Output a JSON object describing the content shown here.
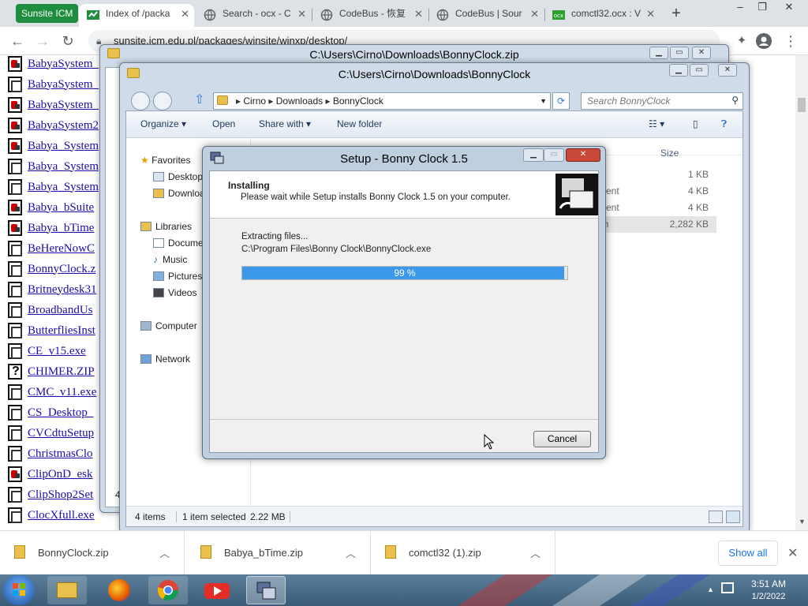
{
  "browser": {
    "profile_label": "Sunsite ICM",
    "tabs": [
      {
        "label": "Index of /packa",
        "active": true
      },
      {
        "label": "Search - ocx - C"
      },
      {
        "label": "CodeBus - 恢复"
      },
      {
        "label": "CodeBus | Sour"
      },
      {
        "label": "comctl32.ocx : V"
      }
    ],
    "new_tab_label": "+",
    "url": "sunsite.icm.edu.pl/packages/winsite/winxp/desktop/",
    "window_controls": [
      "–",
      "❐",
      "✕"
    ]
  },
  "listing": {
    "files": [
      {
        "name": "BabyaSystem_",
        "icon": "red"
      },
      {
        "name": "BabyaSystem_",
        "icon": "gray"
      },
      {
        "name": "BabyaSystem_",
        "icon": "red"
      },
      {
        "name": "BabyaSystem2",
        "icon": "red"
      },
      {
        "name": "Babya_System",
        "icon": "red"
      },
      {
        "name": "Babya_System",
        "icon": "gray"
      },
      {
        "name": "Babya_System",
        "icon": "gray"
      },
      {
        "name": "Babya_bSuite",
        "icon": "red"
      },
      {
        "name": "Babya_bTime",
        "icon": "red"
      },
      {
        "name": "BeHereNowC",
        "icon": "gray"
      },
      {
        "name": "BonnyClock.z",
        "icon": "gray"
      },
      {
        "name": "Britneydesk31",
        "icon": "gray"
      },
      {
        "name": "BroadbandUs",
        "icon": "gray"
      },
      {
        "name": "ButterfliesInst",
        "icon": "gray"
      },
      {
        "name": "CE_v15.exe",
        "icon": "gray"
      },
      {
        "name": "CHIMER.ZIP",
        "icon": "q"
      },
      {
        "name": "CMC_v11.exe",
        "icon": "gray"
      },
      {
        "name": "CS_Desktop_",
        "icon": "gray"
      },
      {
        "name": "CVCdtuSetup",
        "icon": "gray"
      },
      {
        "name": "ChristmasClo",
        "icon": "gray"
      },
      {
        "name": "ClipOnD_esk",
        "icon": "red"
      },
      {
        "name": "ClipShop2Set",
        "icon": "gray"
      },
      {
        "name": "ClocXfull.exe",
        "icon": "gray"
      }
    ]
  },
  "zip_window": {
    "title": "C:\\Users\\Cirno\\Downloads\\BonnyClock.zip",
    "status_fragment": "4"
  },
  "explorer": {
    "title": "C:\\Users\\Cirno\\Downloads\\BonnyClock",
    "breadcrumb": [
      "Cirno",
      "Downloads",
      "BonnyClock"
    ],
    "search_placeholder": "Search BonnyClock",
    "commands": {
      "organize": "Organize ▾",
      "open": "Open",
      "share_with": "Share with ▾",
      "new_folder": "New folder"
    },
    "nav": {
      "favorites": "Favorites",
      "desktop": "Desktop",
      "downloads": "Downloa",
      "libraries": "Libraries",
      "documents": "Documen",
      "music": "Music",
      "pictures": "Pictures",
      "videos": "Videos",
      "computer": "Computer",
      "network": "Network"
    },
    "size_header": "Size",
    "rows": [
      {
        "type_fragment": "",
        "size": "1 KB"
      },
      {
        "type_fragment": "ment",
        "size": "4 KB"
      },
      {
        "type_fragment": "ment",
        "size": "4 KB"
      },
      {
        "type_fragment": "on",
        "size": "2,282 KB",
        "selected": true
      }
    ],
    "status_items": "4 items",
    "status_selected": "1 item selected",
    "status_size": "2.22 MB"
  },
  "setup": {
    "title": "Setup - Bonny Clock 1.5",
    "heading": "Installing",
    "subheading": "Please wait while Setup installs Bonny Clock 1.5 on your computer.",
    "status_line": "Extracting files...",
    "current_file": "C:\\Program Files\\Bonny Clock\\BonnyClock.exe",
    "progress_value": 99,
    "progress_label": "99 %",
    "cancel_label": "Cancel"
  },
  "downloads": {
    "items": [
      {
        "name": "BonnyClock.zip"
      },
      {
        "name": "Babya_bTime.zip"
      },
      {
        "name": "comctl32 (1).zip"
      }
    ],
    "show_all_label": "Show all",
    "close_label": "✕"
  },
  "taskbar": {
    "time": "3:51 AM",
    "date": "1/2/2022"
  },
  "colors": {
    "progress": "#3c98e8",
    "profile_chip": "#1e8e3e",
    "link": "#1a0dab"
  }
}
